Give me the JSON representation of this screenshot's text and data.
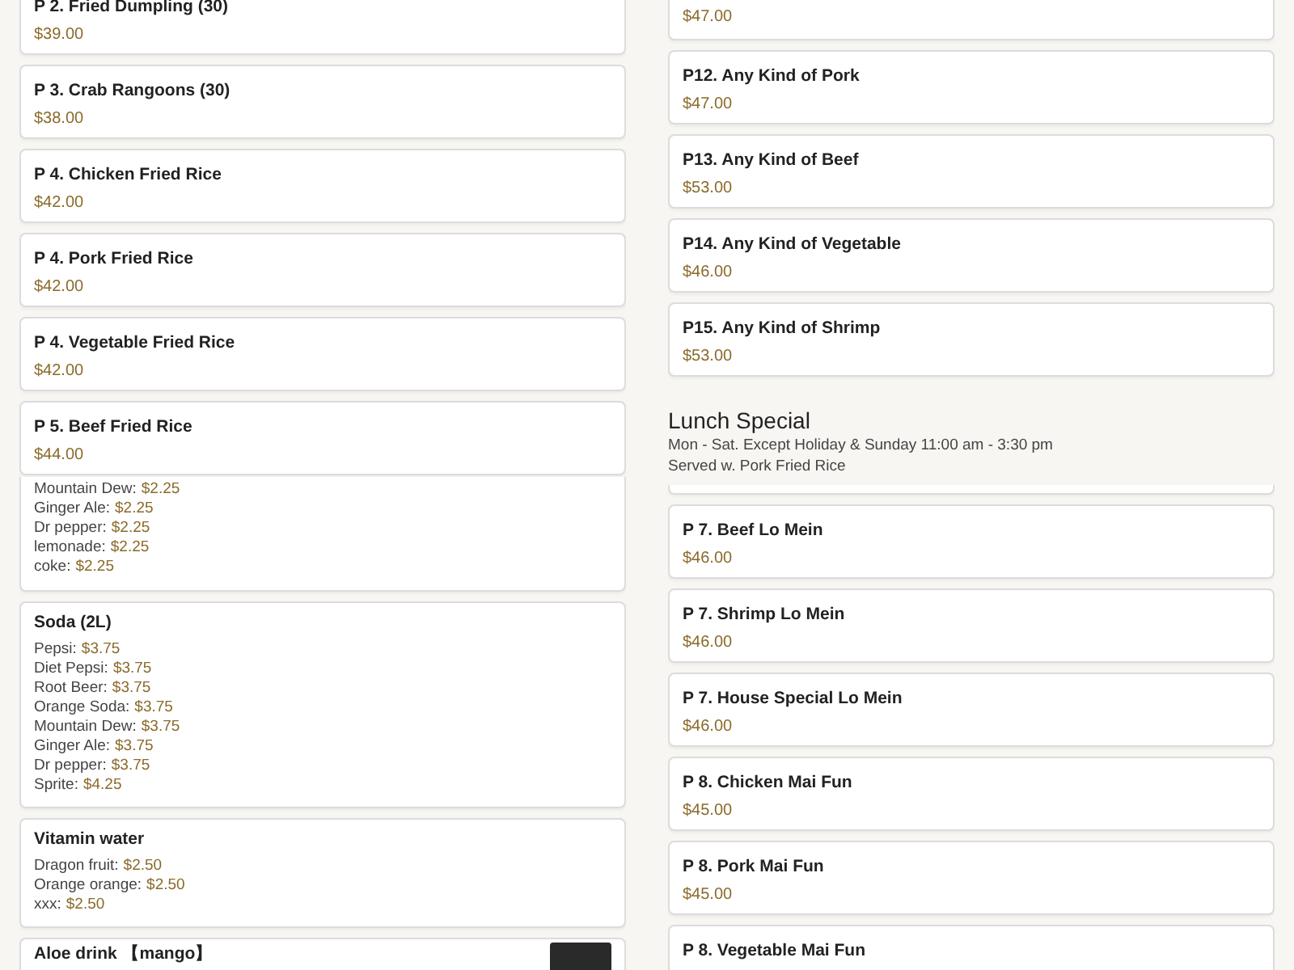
{
  "left_column": {
    "top_items": [
      {
        "kind": "priced",
        "title": "P 2. Fried Dumpling (30)",
        "price": "$39.00"
      },
      {
        "kind": "priced",
        "title": "P 3. Crab Rangoons (30)",
        "price": "$38.00"
      },
      {
        "kind": "priced",
        "title": "P 4. Chicken Fried Rice",
        "price": "$42.00"
      },
      {
        "kind": "priced",
        "title": "P 4. Pork Fried Rice",
        "price": "$42.00"
      },
      {
        "kind": "priced",
        "title": "P 4. Vegetable Fried Rice",
        "price": "$42.00"
      },
      {
        "kind": "priced",
        "title": "P 5. Beef Fried Rice",
        "price": "$44.00"
      }
    ],
    "bottom_items": [
      {
        "kind": "list",
        "lines": [
          {
            "name": "Mountain Dew:",
            "price": "$2.25"
          },
          {
            "name": "Ginger Ale:",
            "price": "$2.25"
          },
          {
            "name": "Dr pepper:",
            "price": "$2.25"
          },
          {
            "name": "lemonade:",
            "price": "$2.25"
          },
          {
            "name": "coke:",
            "price": "$2.25"
          }
        ]
      },
      {
        "kind": "list",
        "title": "Soda (2L)",
        "lines": [
          {
            "name": "Pepsi:",
            "price": "$3.75"
          },
          {
            "name": "Diet Pepsi:",
            "price": "$3.75"
          },
          {
            "name": "Root Beer:",
            "price": "$3.75"
          },
          {
            "name": "Orange Soda:",
            "price": "$3.75"
          },
          {
            "name": "Mountain Dew:",
            "price": "$3.75"
          },
          {
            "name": "Ginger Ale:",
            "price": "$3.75"
          },
          {
            "name": "Dr pepper:",
            "price": "$3.75"
          },
          {
            "name": "Sprite:",
            "price": "$4.25"
          }
        ]
      },
      {
        "kind": "list",
        "title": "Vitamin water",
        "lines": [
          {
            "name": "Dragon fruit:",
            "price": "$2.50"
          },
          {
            "name": "Orange orange:",
            "price": "$2.50"
          },
          {
            "name": "xxx:",
            "price": "$2.50"
          }
        ]
      },
      {
        "kind": "photo",
        "title": "Aloe drink 【mango】"
      }
    ]
  },
  "right_column": {
    "top_items": [
      {
        "kind": "priced",
        "price": "$47.00"
      },
      {
        "kind": "priced",
        "title": "P12. Any Kind of Pork",
        "price": "$47.00"
      },
      {
        "kind": "priced",
        "title": "P13. Any Kind of Beef",
        "price": "$53.00"
      },
      {
        "kind": "priced",
        "title": "P14. Any Kind of Vegetable",
        "price": "$46.00"
      },
      {
        "kind": "priced",
        "title": "P15. Any Kind of Shrimp",
        "price": "$53.00"
      }
    ],
    "section": {
      "title": "Lunch Special",
      "notes": [
        "Mon - Sat. Except Holiday & Sunday 11:00 am - 3:30 pm",
        "Served w. Pork Fried Rice"
      ]
    },
    "bottom_items": [
      {
        "kind": "priced",
        "title": "P 7. Beef Lo Mein",
        "price": "$46.00"
      },
      {
        "kind": "priced",
        "title": "P 7. Shrimp Lo Mein",
        "price": "$46.00"
      },
      {
        "kind": "priced",
        "title": "P 7. House Special Lo Mein",
        "price": "$46.00"
      },
      {
        "kind": "priced",
        "title": "P 8. Chicken Mai Fun",
        "price": "$45.00"
      },
      {
        "kind": "priced",
        "title": "P 8. Pork Mai Fun",
        "price": "$45.00"
      },
      {
        "kind": "priced",
        "title": "P 8. Vegetable Mai Fun"
      }
    ]
  }
}
